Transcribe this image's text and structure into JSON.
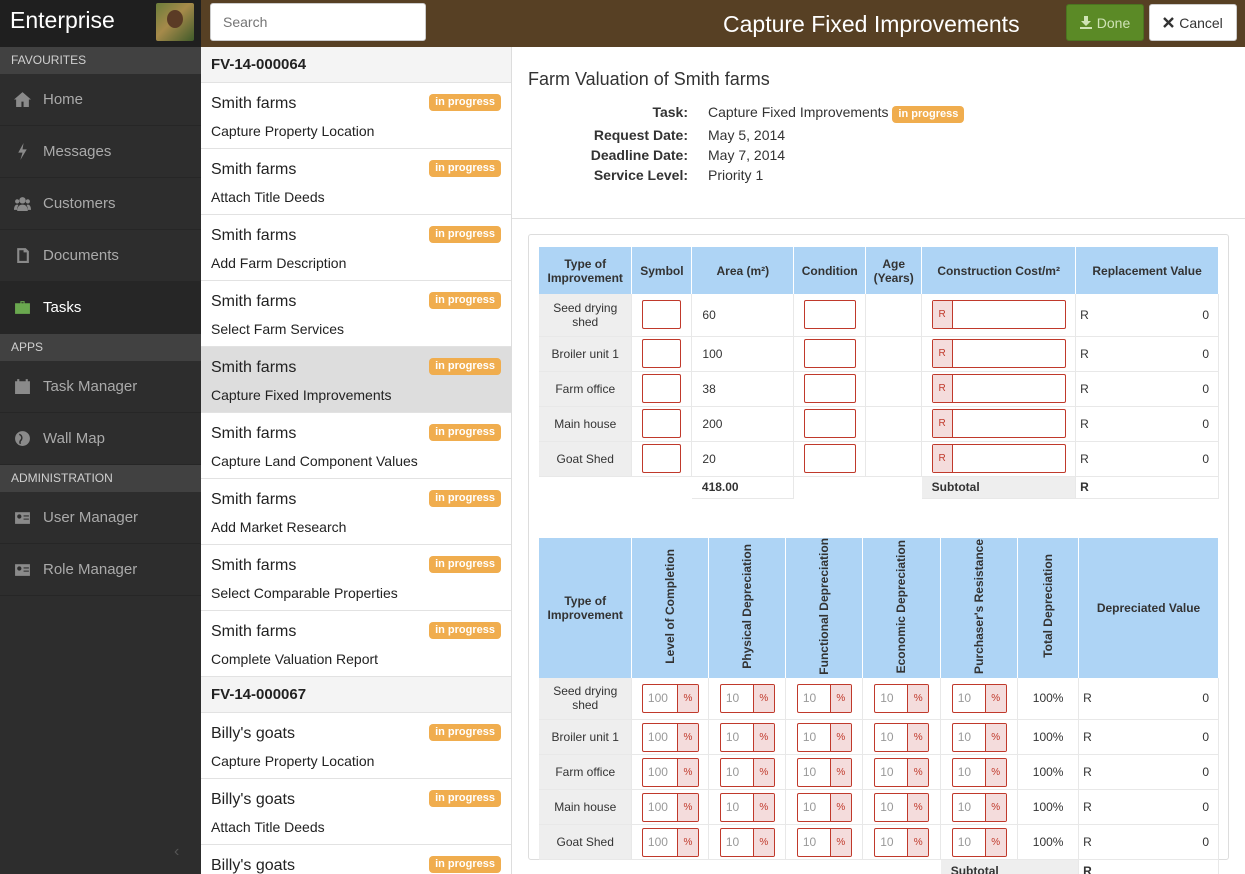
{
  "app": {
    "brand": "Enterprise",
    "page_title": "Capture Fixed Improvements"
  },
  "sidebar": {
    "sections": [
      {
        "label": "Favourites",
        "items": [
          {
            "label": "Home",
            "icon": "home-icon"
          },
          {
            "label": "Messages",
            "icon": "flash-icon"
          },
          {
            "label": "Customers",
            "icon": "users-icon"
          },
          {
            "label": "Documents",
            "icon": "document-icon"
          },
          {
            "label": "Tasks",
            "icon": "briefcase-icon",
            "active": true
          }
        ]
      },
      {
        "label": "Apps",
        "items": [
          {
            "label": "Task Manager",
            "icon": "calendar-icon"
          },
          {
            "label": "Wall Map",
            "icon": "globe-icon"
          }
        ]
      },
      {
        "label": "Administration",
        "items": [
          {
            "label": "User Manager",
            "icon": "id-card-icon"
          },
          {
            "label": "Role Manager",
            "icon": "id-card-icon"
          }
        ]
      }
    ]
  },
  "search": {
    "placeholder": "Search"
  },
  "toolbar": {
    "done_label": "Done",
    "cancel_label": "Cancel"
  },
  "tasklist": [
    {
      "group": "FV-14-000064",
      "tasks": [
        {
          "name": "Smith farms",
          "sub": "Capture Property Location",
          "status": "in progress"
        },
        {
          "name": "Smith farms",
          "sub": "Attach Title Deeds",
          "status": "in progress"
        },
        {
          "name": "Smith farms",
          "sub": "Add Farm Description",
          "status": "in progress"
        },
        {
          "name": "Smith farms",
          "sub": "Select Farm Services",
          "status": "in progress"
        },
        {
          "name": "Smith farms",
          "sub": "Capture Fixed Improvements",
          "status": "in progress",
          "selected": true
        },
        {
          "name": "Smith farms",
          "sub": "Capture Land Component Values",
          "status": "in progress"
        },
        {
          "name": "Smith farms",
          "sub": "Add Market Research",
          "status": "in progress"
        },
        {
          "name": "Smith farms",
          "sub": "Select Comparable Properties",
          "status": "in progress"
        },
        {
          "name": "Smith farms",
          "sub": "Complete Valuation Report",
          "status": "in progress"
        }
      ]
    },
    {
      "group": "FV-14-000067",
      "tasks": [
        {
          "name": "Billy's goats",
          "sub": "Capture Property Location",
          "status": "in progress"
        },
        {
          "name": "Billy's goats",
          "sub": "Attach Title Deeds",
          "status": "in progress"
        },
        {
          "name": "Billy's goats",
          "sub": "",
          "status": "in progress"
        }
      ]
    }
  ],
  "detail": {
    "title": "Farm Valuation of Smith farms",
    "task_label": "Task:",
    "task_value": "Capture Fixed Improvements",
    "task_status": "in progress",
    "request_label": "Request Date:",
    "request_value": "May 5, 2014",
    "deadline_label": "Deadline Date:",
    "deadline_value": "May 7, 2014",
    "service_label": "Service Level:",
    "service_value": "Priority 1"
  },
  "improvements": {
    "headers": [
      "Type of Improvement",
      "Symbol",
      "Area (m²)",
      "Condition",
      "Age (Years)",
      "Construction Cost/m²",
      "Replacement Value"
    ],
    "rows": [
      {
        "type": "Seed drying shed",
        "area": "60",
        "currency": "R",
        "value": "0"
      },
      {
        "type": "Broiler unit 1",
        "area": "100",
        "currency": "R",
        "value": "0"
      },
      {
        "type": "Farm office",
        "area": "38",
        "currency": "R",
        "value": "0"
      },
      {
        "type": "Main house",
        "area": "200",
        "currency": "R",
        "value": "0"
      },
      {
        "type": "Goat Shed",
        "area": "20",
        "currency": "R",
        "value": "0"
      }
    ],
    "cost_prefix": "R",
    "area_total": "418.00",
    "subtotal_label": "Subtotal",
    "subtotal_value": "R"
  },
  "depreciation": {
    "headers": [
      "Type of Improvement",
      "Level of Completion",
      "Physical Depreciation",
      "Functional Depreciation",
      "Economic Depreciation",
      "Purchaser's Resistance",
      "Total Depreciation",
      "Depreciated Value"
    ],
    "rows": [
      {
        "type": "Seed drying shed",
        "completion": "100",
        "physical": "10",
        "functional": "10",
        "economic": "10",
        "resistance": "10",
        "total": "100%",
        "currency": "R",
        "value": "0"
      },
      {
        "type": "Broiler unit 1",
        "completion": "100",
        "physical": "10",
        "functional": "10",
        "economic": "10",
        "resistance": "10",
        "total": "100%",
        "currency": "R",
        "value": "0"
      },
      {
        "type": "Farm office",
        "completion": "100",
        "physical": "10",
        "functional": "10",
        "economic": "10",
        "resistance": "10",
        "total": "100%",
        "currency": "R",
        "value": "0"
      },
      {
        "type": "Main house",
        "completion": "100",
        "physical": "10",
        "functional": "10",
        "economic": "10",
        "resistance": "10",
        "total": "100%",
        "currency": "R",
        "value": "0"
      },
      {
        "type": "Goat Shed",
        "completion": "100",
        "physical": "10",
        "functional": "10",
        "economic": "10",
        "resistance": "10",
        "total": "100%",
        "currency": "R",
        "value": "0"
      }
    ],
    "pct_suffix": "%",
    "subtotal_label": "Subtotal",
    "subtotal_value": "R"
  }
}
